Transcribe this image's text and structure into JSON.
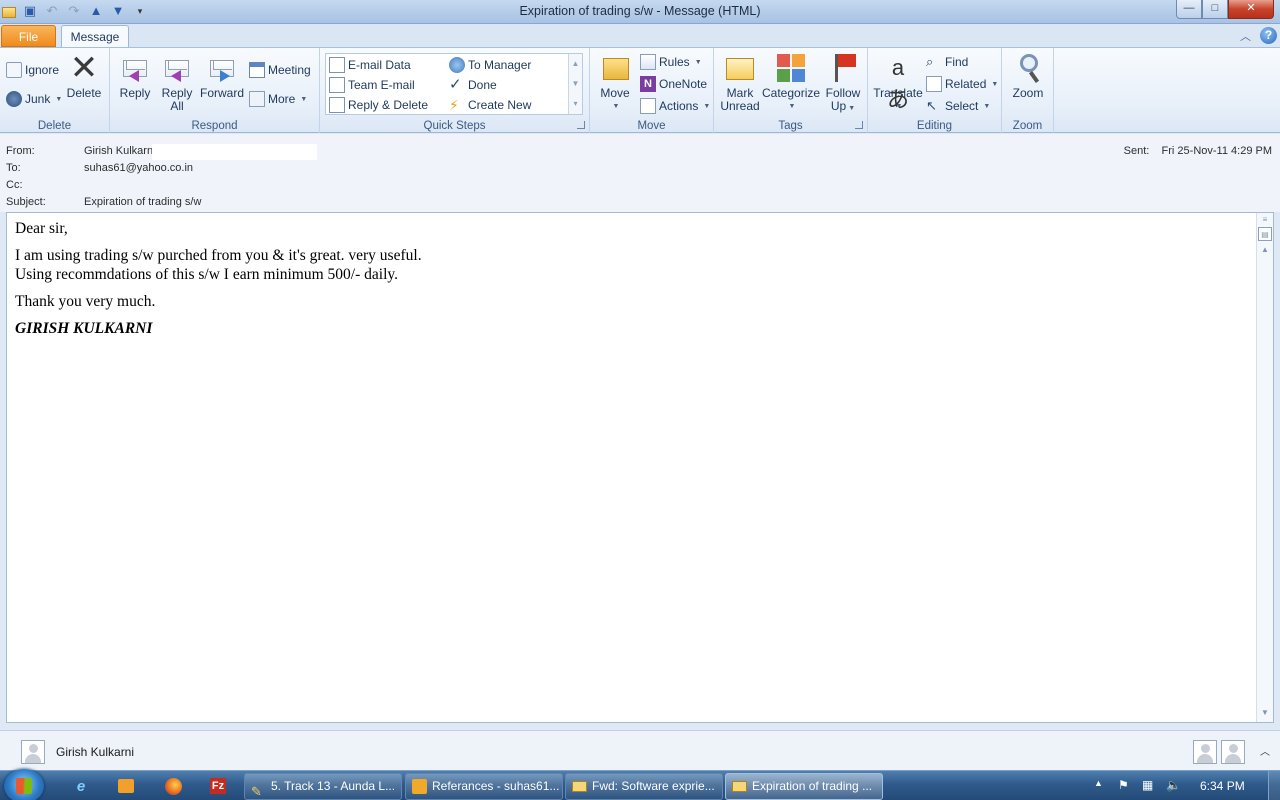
{
  "window": {
    "title": "Expiration of trading s/w  -  Message (HTML)",
    "min": "—",
    "max": "□",
    "close": "✕"
  },
  "tabs": {
    "file": "File",
    "message": "Message"
  },
  "ribbon": {
    "delete_group": {
      "label": "Delete",
      "ignore": "Ignore",
      "junk": "Junk",
      "delete": "Delete"
    },
    "respond_group": {
      "label": "Respond",
      "reply": "Reply",
      "reply_all_1": "Reply",
      "reply_all_2": "All",
      "forward": "Forward",
      "meeting": "Meeting",
      "more": "More"
    },
    "quicksteps_group": {
      "label": "Quick Steps",
      "items": [
        "E-mail Data",
        "To Manager",
        "Team E-mail",
        "Done",
        "Reply & Delete",
        "Create New"
      ]
    },
    "move_group": {
      "label": "Move",
      "move": "Move",
      "rules": "Rules",
      "onenote": "OneNote",
      "actions": "Actions"
    },
    "tags_group": {
      "label": "Tags",
      "mark_unread_1": "Mark",
      "mark_unread_2": "Unread",
      "categorize": "Categorize",
      "follow_up_1": "Follow",
      "follow_up_2": "Up"
    },
    "editing_group": {
      "label": "Editing",
      "translate": "Translate",
      "find": "Find",
      "related": "Related",
      "select": "Select"
    },
    "zoom_group": {
      "label": "Zoom",
      "zoom": "Zoom"
    }
  },
  "header": {
    "from_label": "From:",
    "from_value": "Girish Kulkarni",
    "to_label": "To:",
    "to_value": "suhas61@yahoo.co.in",
    "cc_label": "Cc:",
    "subject_label": "Subject:",
    "subject_value": "Expiration of trading s/w",
    "sent_label": "Sent:",
    "sent_value": "Fri 25-Nov-11 4:29 PM"
  },
  "body": {
    "greeting": "Dear sir,",
    "line1": "I am using trading s/w purched from you & it's great. very useful.",
    "line2": "Using recommdations of this s/w I earn minimum 500/- daily.",
    "thanks": "Thank you very much.",
    "signature": "GIRISH KULKARNI"
  },
  "people_pane": {
    "name": "Girish Kulkarni"
  },
  "taskbar": {
    "tasks": [
      "5. Track 13 - Aunda L...",
      "Referances - suhas61...",
      "Fwd: Software exprie...",
      "Expiration of trading ..."
    ],
    "clock": "6:34 PM"
  },
  "colors": {
    "file_tab": "#f08a1c",
    "ribbon_bg": "#e7eff9",
    "taskbar": "#2f5b8c",
    "accent_text": "#1e395b"
  }
}
